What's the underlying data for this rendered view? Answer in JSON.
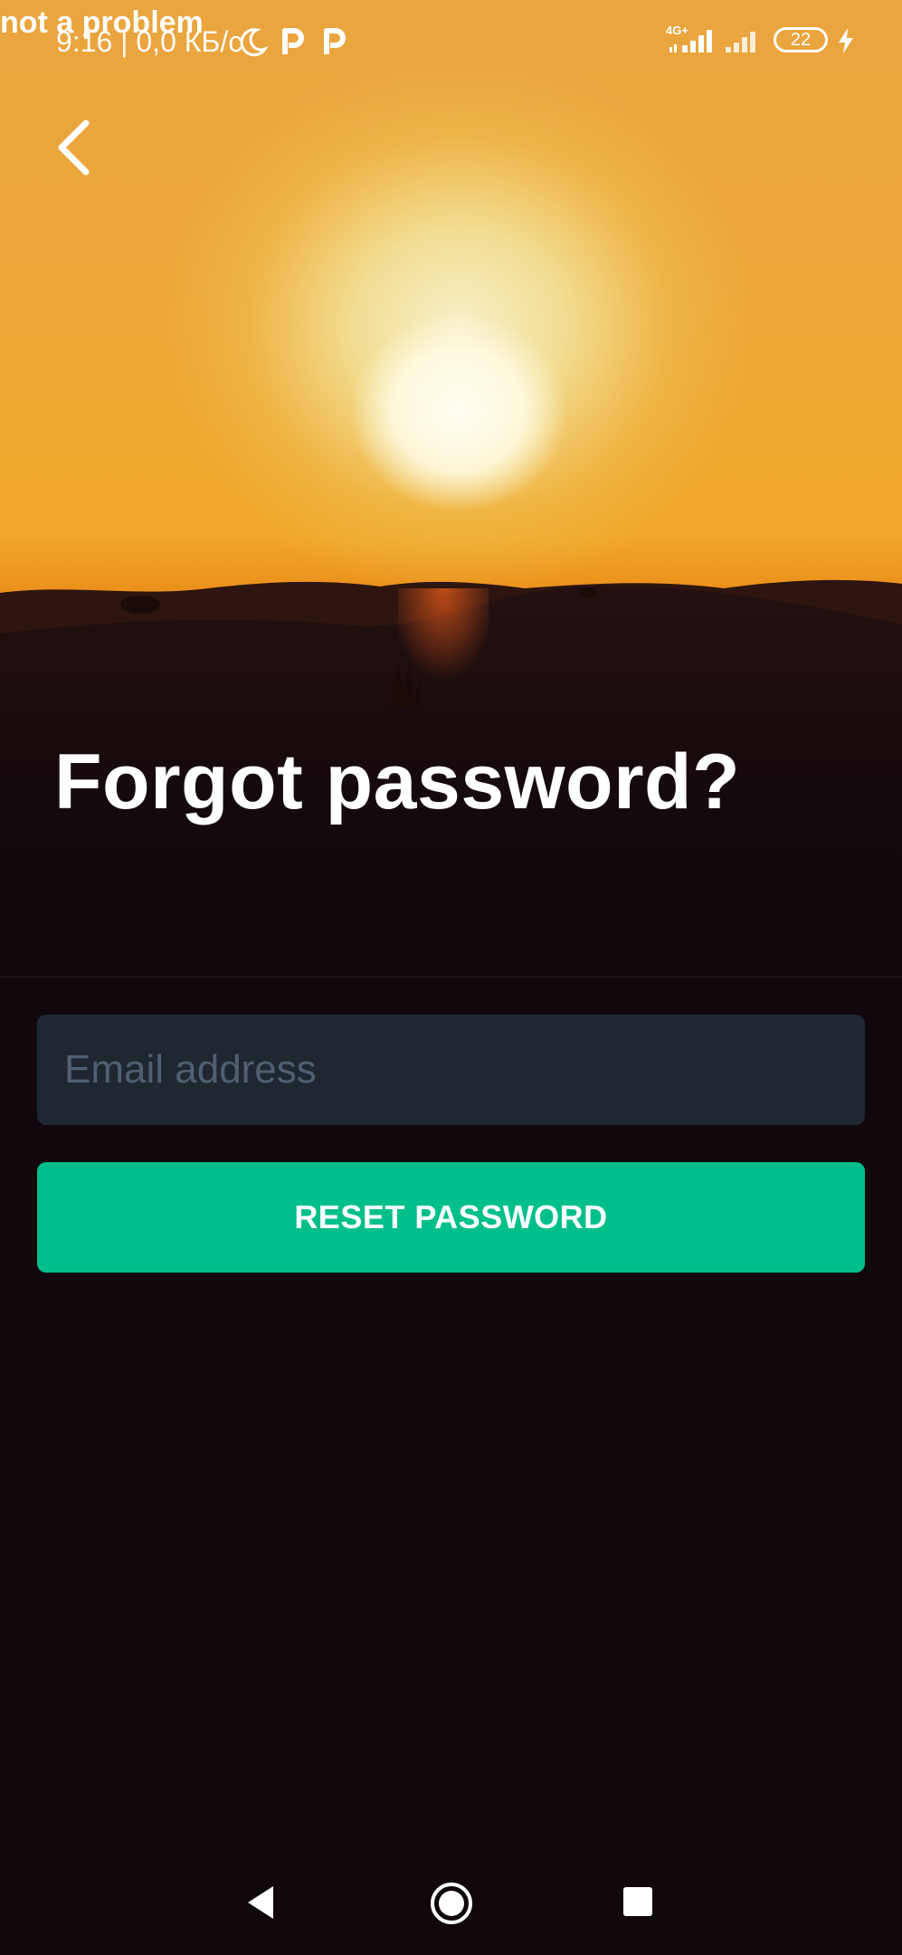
{
  "overlay_text": "not a problem",
  "status_bar": {
    "time_and_speed": "9:16 | 0,0 КБ/с",
    "network_label": "4G+",
    "battery_level": "22"
  },
  "page": {
    "title": "Forgot password?"
  },
  "form": {
    "email_placeholder": "Email address",
    "email_value": "",
    "reset_button_label": "RESET PASSWORD"
  },
  "colors": {
    "background": "#10080d",
    "input_background": "#1f2731",
    "accent": "#00bf8b"
  },
  "icons": {
    "back": "chevron-left-icon",
    "nav_back": "triangle-back-icon",
    "nav_home": "circle-home-icon",
    "nav_recents": "square-recents-icon"
  }
}
